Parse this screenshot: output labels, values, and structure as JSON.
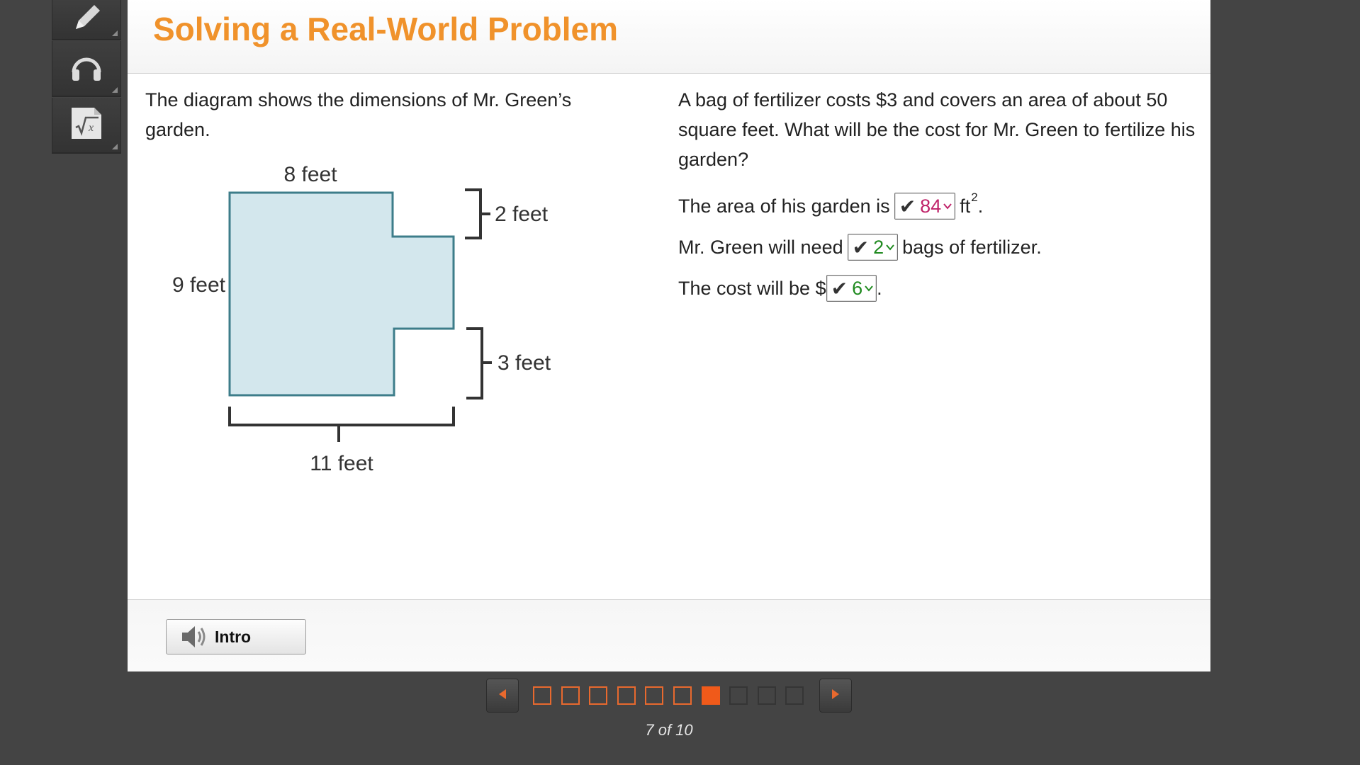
{
  "lesson": {
    "title": "Solving a Real-World Problem"
  },
  "tools": [
    {
      "name": "pencil-icon"
    },
    {
      "name": "headphones-icon"
    },
    {
      "name": "math-icon"
    }
  ],
  "problem": {
    "intro": "The diagram shows the dimensions of Mr. Green’s garden.",
    "question": "A bag of fertilizer costs $3 and covers an area of about 50 square feet. What will be the cost for Mr. Green to fertilize his garden?"
  },
  "diagram": {
    "labels": {
      "top": "8 feet",
      "left": "9 feet",
      "notch_top": "2 feet",
      "notch_bottom": "3 feet",
      "bottom": "11 feet"
    },
    "fill_color": "#d3e7ed",
    "stroke_color": "#3d7d8a"
  },
  "answers": {
    "area": {
      "prefix": "The area of his garden is",
      "check": "✔",
      "value": "84",
      "unit": "ft",
      "unit_sup": "2",
      "suffix": "."
    },
    "bags": {
      "prefix": "Mr. Green will need",
      "check": "✔",
      "value": "2",
      "suffix": "bags of fertilizer."
    },
    "cost": {
      "prefix": "The cost will be $",
      "check": "✔",
      "value": "6",
      "suffix": "."
    }
  },
  "footer": {
    "intro_label": "Intro"
  },
  "nav": {
    "current": 7,
    "total": 10,
    "page_text": "7 of 10",
    "colors": {
      "done": "#e8692e",
      "current": "#f05a1a",
      "todo": "#353535"
    }
  }
}
